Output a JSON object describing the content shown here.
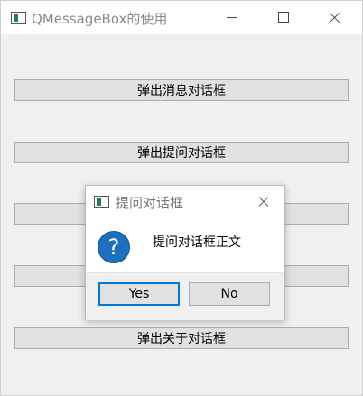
{
  "window": {
    "title": "QMessageBox的使用",
    "icon": "app-window-icon",
    "controls": [
      "minimize-icon",
      "maximize-icon",
      "close-icon"
    ]
  },
  "buttons": {
    "b1": "弹出消息对话框",
    "b2": "弹出提问对话框",
    "b3": "",
    "b4": "",
    "b5": "弹出关于对话框"
  },
  "dialog": {
    "title": "提问对话框",
    "icon": "question-icon",
    "text": "提问对话框正文",
    "yes_label": "Yes",
    "no_label": "No"
  },
  "colors": {
    "accent": "#0078d7",
    "question_icon": "#1f6fc0"
  }
}
